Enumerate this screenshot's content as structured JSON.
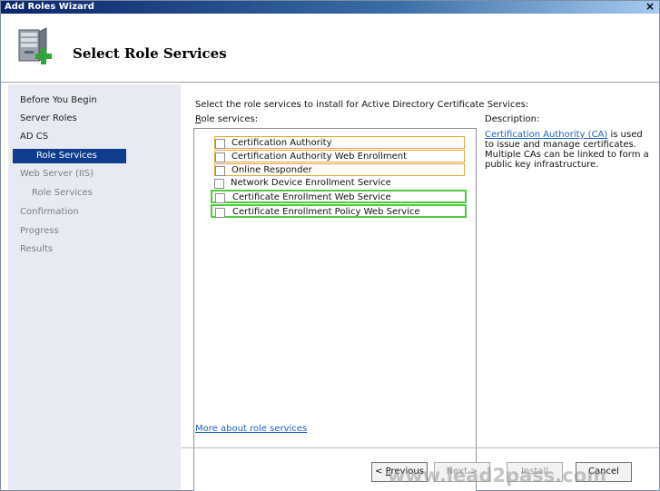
{
  "window": {
    "title": "Add Roles Wizard",
    "close_glyph": "×"
  },
  "header": {
    "title": "Select Role Services",
    "icon": "server-role-add-icon"
  },
  "sidebar": {
    "items": [
      {
        "label": "Before You Begin",
        "level": "top",
        "state": "normal"
      },
      {
        "label": "Server Roles",
        "level": "top",
        "state": "normal"
      },
      {
        "label": "AD CS",
        "level": "top",
        "state": "normal"
      },
      {
        "label": "Role Services",
        "level": "sub",
        "state": "active"
      },
      {
        "label": "Web Server (IIS)",
        "level": "top",
        "state": "dim"
      },
      {
        "label": "Role Services",
        "level": "sub",
        "state": "dim"
      },
      {
        "label": "Confirmation",
        "level": "top",
        "state": "dim"
      },
      {
        "label": "Progress",
        "level": "top",
        "state": "dim"
      },
      {
        "label": "Results",
        "level": "top",
        "state": "dim"
      }
    ]
  },
  "main": {
    "instruction": "Select the role services to install for Active Directory Certificate Services:",
    "role_services_label_prefix": "R",
    "role_services_label_rest": "ole services:",
    "role_services": [
      {
        "label": "Certification Authority",
        "checked": false,
        "highlight": "orange"
      },
      {
        "label": "Certification Authority Web Enrollment",
        "checked": false,
        "highlight": "orange"
      },
      {
        "label": "Online Responder",
        "checked": false,
        "highlight": "orange"
      },
      {
        "label": "Network Device Enrollment Service",
        "checked": false,
        "highlight": "none"
      },
      {
        "label": "Certificate Enrollment Web Service",
        "checked": false,
        "highlight": "green"
      },
      {
        "label": "Certificate Enrollment Policy Web Service",
        "checked": false,
        "highlight": "green"
      }
    ],
    "description_label": "Description:",
    "description_link": "Certification Authority (CA)",
    "description_text": " is used to issue and manage certificates. Multiple CAs can be linked to form a public key infrastructure.",
    "more_link": "More about role services"
  },
  "buttons": {
    "previous_prefix": "< ",
    "previous_underlined": "P",
    "previous_rest": "revious",
    "next": "Next >",
    "install": "Install",
    "cancel": "Cancel"
  },
  "watermark": "www.lead2pass.com",
  "colors": {
    "titlebar_start": "#0a246a",
    "active_nav": "#0f3c8c",
    "link": "#1f5fc0",
    "highlight_orange": "#e7a43a",
    "highlight_green": "#4ecc3b"
  }
}
